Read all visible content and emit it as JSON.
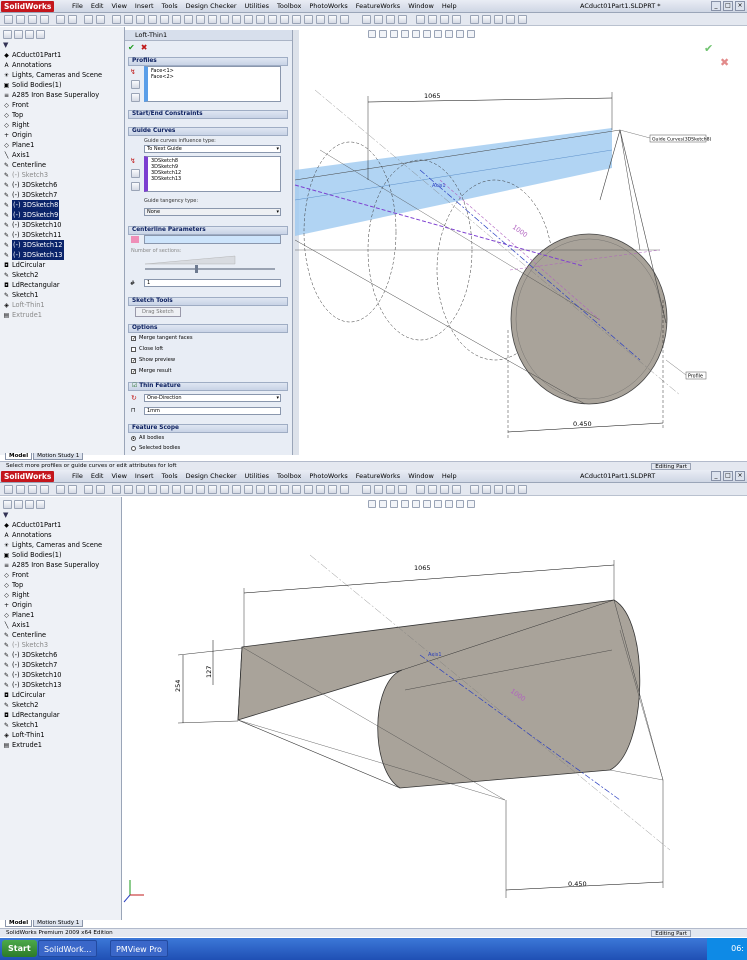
{
  "app": {
    "logo": "SolidWorks",
    "menus": [
      "File",
      "Edit",
      "View",
      "Insert",
      "Tools",
      "Design Checker",
      "Utilities",
      "Toolbox",
      "PhotoWorks",
      "FeatureWorks",
      "Window",
      "Help"
    ],
    "doc_title": "ACduct01Part1.SLDPRT *",
    "doc_title2": "ACduct01Part1.SLDPRT"
  },
  "tree1": {
    "items": [
      {
        "label": "ACduct01Part1",
        "icon": "part-icon",
        "style": ""
      },
      {
        "label": "Annotations",
        "icon": "annotation-icon",
        "style": ""
      },
      {
        "label": "Lights, Cameras and Scene",
        "icon": "lights-icon",
        "style": ""
      },
      {
        "label": "Solid Bodies(1)",
        "icon": "solid-bodies-icon",
        "style": ""
      },
      {
        "label": "A285 Iron Base Superalloy",
        "icon": "material-icon",
        "style": ""
      },
      {
        "label": "Front",
        "icon": "plane-icon",
        "style": ""
      },
      {
        "label": "Top",
        "icon": "plane-icon",
        "style": ""
      },
      {
        "label": "Right",
        "icon": "plane-icon",
        "style": ""
      },
      {
        "label": "Origin",
        "icon": "origin-icon",
        "style": ""
      },
      {
        "label": "Plane1",
        "icon": "plane-icon",
        "style": ""
      },
      {
        "label": "Axis1",
        "icon": "axis-icon",
        "style": ""
      },
      {
        "label": "Centerline",
        "icon": "sketch-icon",
        "style": ""
      },
      {
        "label": "(-) Sketch3",
        "icon": "sketch-icon",
        "style": "gray"
      },
      {
        "label": "(-) 3DSketch6",
        "icon": "sketch3d-icon",
        "style": ""
      },
      {
        "label": "(-) 3DSketch7",
        "icon": "sketch3d-icon",
        "style": ""
      },
      {
        "label": "(-) 3DSketch8",
        "icon": "sketch3d-icon",
        "style": "sel"
      },
      {
        "label": "(-) 3DSketch9",
        "icon": "sketch3d-icon",
        "style": "sel"
      },
      {
        "label": "(-) 3DSketch10",
        "icon": "sketch3d-icon",
        "style": ""
      },
      {
        "label": "(-) 3DSketch11",
        "icon": "sketch3d-icon",
        "style": ""
      },
      {
        "label": "(-) 3DSketch12",
        "icon": "sketch3d-icon",
        "style": "sel"
      },
      {
        "label": "(-) 3DSketch13",
        "icon": "sketch3d-icon",
        "style": "sel"
      },
      {
        "label": "LdCircular",
        "icon": "library-feature-icon",
        "style": ""
      },
      {
        "label": "Sketch2",
        "icon": "sketch-icon",
        "style": ""
      },
      {
        "label": "LdRectangular",
        "icon": "library-feature-icon",
        "style": ""
      },
      {
        "label": "Sketch1",
        "icon": "sketch-icon",
        "style": ""
      },
      {
        "label": "Loft-Thin1",
        "icon": "loft-icon",
        "style": "gray"
      },
      {
        "label": "Extrude1",
        "icon": "extrude-icon",
        "style": "gray"
      }
    ]
  },
  "tree2": {
    "items": [
      {
        "label": "ACduct01Part1",
        "icon": "part-icon",
        "style": ""
      },
      {
        "label": "Annotations",
        "icon": "annotation-icon",
        "style": ""
      },
      {
        "label": "Lights, Cameras and Scene",
        "icon": "lights-icon",
        "style": ""
      },
      {
        "label": "Solid Bodies(1)",
        "icon": "solid-bodies-icon",
        "style": ""
      },
      {
        "label": "A285 Iron Base Superalloy",
        "icon": "material-icon",
        "style": ""
      },
      {
        "label": "Front",
        "icon": "plane-icon",
        "style": ""
      },
      {
        "label": "Top",
        "icon": "plane-icon",
        "style": ""
      },
      {
        "label": "Right",
        "icon": "plane-icon",
        "style": ""
      },
      {
        "label": "Origin",
        "icon": "origin-icon",
        "style": ""
      },
      {
        "label": "Plane1",
        "icon": "plane-icon",
        "style": ""
      },
      {
        "label": "Axis1",
        "icon": "axis-icon",
        "style": ""
      },
      {
        "label": "Centerline",
        "icon": "sketch-icon",
        "style": ""
      },
      {
        "label": "(-) Sketch3",
        "icon": "sketch-icon",
        "style": "gray"
      },
      {
        "label": "(-) 3DSketch6",
        "icon": "sketch3d-icon",
        "style": ""
      },
      {
        "label": "(-) 3DSketch7",
        "icon": "sketch3d-icon",
        "style": ""
      },
      {
        "label": "(-) 3DSketch10",
        "icon": "sketch3d-icon",
        "style": ""
      },
      {
        "label": "(-) 3DSketch13",
        "icon": "sketch3d-icon",
        "style": ""
      },
      {
        "label": "LdCircular",
        "icon": "library-feature-icon",
        "style": ""
      },
      {
        "label": "Sketch2",
        "icon": "sketch-icon",
        "style": ""
      },
      {
        "label": "LdRectangular",
        "icon": "library-feature-icon",
        "style": ""
      },
      {
        "label": "Sketch1",
        "icon": "sketch-icon",
        "style": ""
      },
      {
        "label": "Loft-Thin1",
        "icon": "loft-icon",
        "style": ""
      },
      {
        "label": "Extrude1",
        "icon": "extrude-icon",
        "style": ""
      }
    ]
  },
  "pm": {
    "title": "Loft-Thin1",
    "sec_profiles": "Profiles",
    "profiles": [
      "Face<1>",
      "Face<2>"
    ],
    "sec_startend": "Start/End Constraints",
    "sec_guides": "Guide Curves",
    "guide_influence_label": "Guide curves influence type:",
    "guide_influence": "To Next Guide",
    "guides": [
      "3DSketch8",
      "3DSketch9",
      "3DSketch12",
      "3DSketch13"
    ],
    "tangency_label": "Guide tangency type:",
    "tangency": "None",
    "sec_centerline": "Centerline Parameters",
    "sections_label": "Number of sections:",
    "sections_value": "1",
    "sec_sketch": "Sketch Tools",
    "drag_sketch": "Drag Sketch",
    "sec_options": "Options",
    "options": [
      "Merge tangent faces",
      "Close loft",
      "Show preview",
      "Merge result"
    ],
    "sec_thin": "Thin Feature",
    "thin_dir": "One-Direction",
    "thin_val": "1mm",
    "sec_scope": "Feature Scope",
    "scope_all": "All bodies",
    "scope_sel": "Selected bodies"
  },
  "dims": {
    "d1065": "1065",
    "d1065b": "1065",
    "d450": "0.450",
    "d450b": "0.450",
    "d254": "254",
    "d127": "127",
    "d1000": "1000",
    "d1000b": "1000"
  },
  "callouts": {
    "guide": "Guide Curves(3DSketch8)",
    "profile": "Profile"
  },
  "tags": {
    "axis": "Axis1",
    "axis2": "Axis1"
  },
  "tabs": [
    "Model",
    "Motion Study 1"
  ],
  "status1": "Select more profiles or guide curves or edit attributes for loft",
  "status2": "SolidWorks Premium 2009 x64 Edition",
  "status_mode": "Editing Part",
  "status_mode2": "Editing Part",
  "taskbar": {
    "start": "Start",
    "task1": "SolidWork...",
    "task2": "PMView Pro",
    "clock": "06:"
  },
  "colors": {
    "highlight": "#0a246a",
    "preview": "#9ec9f0",
    "solid": "#a9a39a",
    "guide": "#7d3fd0"
  }
}
